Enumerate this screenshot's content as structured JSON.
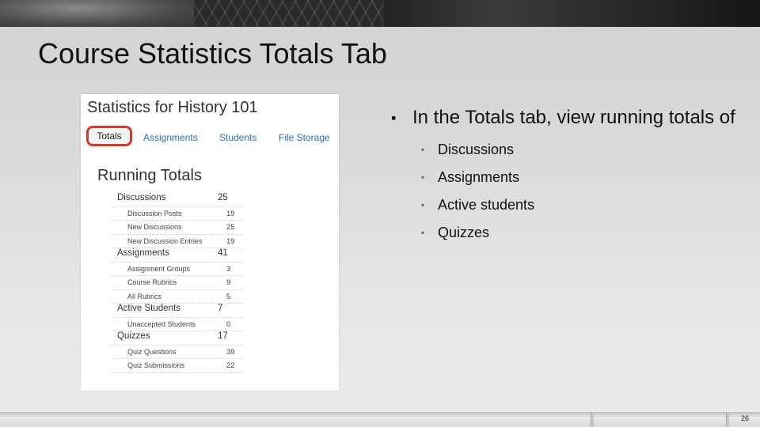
{
  "slide": {
    "title": "Course Statistics Totals Tab",
    "page_number": "26"
  },
  "screenshot": {
    "title": "Statistics for History 101",
    "tabs": {
      "totals": "Totals",
      "assignments": "Assignments",
      "students": "Students",
      "file_storage": "File Storage"
    },
    "section_title": "Running Totals",
    "rows": [
      {
        "label": "Discussions",
        "value": "25",
        "kind": "category"
      },
      {
        "label": "Discussion Posts",
        "value": "19",
        "kind": "sub"
      },
      {
        "label": "New Discussions",
        "value": "25",
        "kind": "sub"
      },
      {
        "label": "New Discussion Entries",
        "value": "19",
        "kind": "sub"
      },
      {
        "label": "Assignments",
        "value": "41",
        "kind": "category"
      },
      {
        "label": "Assignment Groups",
        "value": "3",
        "kind": "sub"
      },
      {
        "label": "Course Rubrics",
        "value": "9",
        "kind": "sub"
      },
      {
        "label": "All Rubrics",
        "value": "5",
        "kind": "sub"
      },
      {
        "label": "Active Students",
        "value": "7",
        "kind": "category"
      },
      {
        "label": "Unaccepted Students",
        "value": "0",
        "kind": "sub"
      },
      {
        "label": "Quizzes",
        "value": "17",
        "kind": "category"
      },
      {
        "label": "Quiz Questions",
        "value": "39",
        "kind": "sub"
      },
      {
        "label": "Quiz Submissions",
        "value": "22",
        "kind": "sub"
      }
    ]
  },
  "bullets": {
    "main": "In the Totals tab, view running totals of",
    "sub": [
      "Discussions",
      "Assignments",
      "Active students",
      "Quizzes"
    ]
  },
  "colors": {
    "tab_link": "#2a6db0",
    "highlight_border": "#d23a2a"
  }
}
